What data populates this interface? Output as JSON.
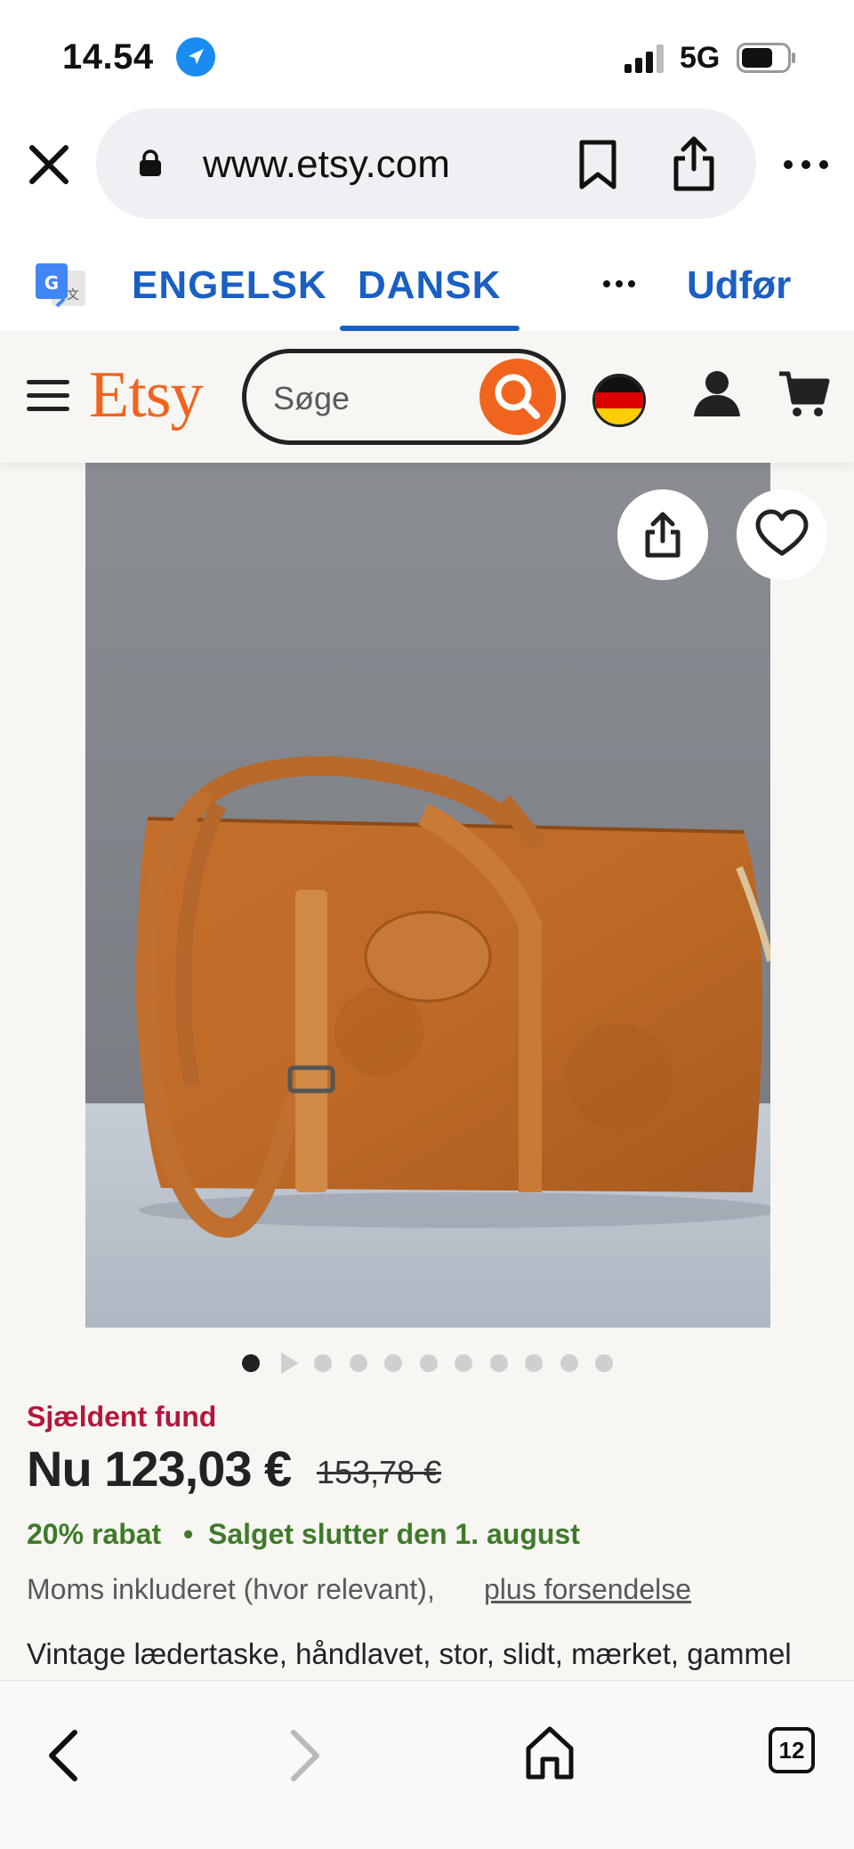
{
  "status_bar": {
    "time": "14.54",
    "network": "5G",
    "icons": [
      "location-arrow-icon",
      "signal-icon",
      "battery-icon"
    ]
  },
  "browser": {
    "url": "www.etsy.com",
    "icons": [
      "close-icon",
      "lock-icon",
      "bookmark-icon",
      "share-icon",
      "more-icon"
    ]
  },
  "translate_bar": {
    "tab_source": "ENGELSK",
    "tab_target": "DANSK",
    "active_tab": "DANSK",
    "done_label": "Udfør",
    "icons": [
      "google-translate-icon",
      "more-icon"
    ]
  },
  "etsy_header": {
    "logo": "Etsy",
    "search": {
      "placeholder": "Søge",
      "value": ""
    },
    "icons": [
      "menu-icon",
      "search-icon",
      "german-flag-icon",
      "user-icon",
      "cart-icon"
    ]
  },
  "product": {
    "image_count": 11,
    "active_image": 1,
    "rare_label": "Sjældent fund",
    "price_now": "Nu 123,03 €",
    "price_old": "153,78 €",
    "discount": "20% rabat",
    "separator": "•",
    "sale_ends": "Salget slutter den 1. august",
    "vat_text": "Moms inkluderet (hvor relevant),",
    "shipping_link": "plus forsendelse",
    "title": "Vintage lædertaske, håndlavet, stor, slidt, mærket, gammel taske"
  },
  "bottom_bar": {
    "open_tabs": "12",
    "icons": [
      "back-icon",
      "forward-icon",
      "home-icon",
      "tabs-icon"
    ]
  },
  "colors": {
    "etsy_orange": "#f1641e",
    "link_blue": "#1a5fc4",
    "rare_red": "#b3173b",
    "discount_green": "#3f7a2a"
  }
}
